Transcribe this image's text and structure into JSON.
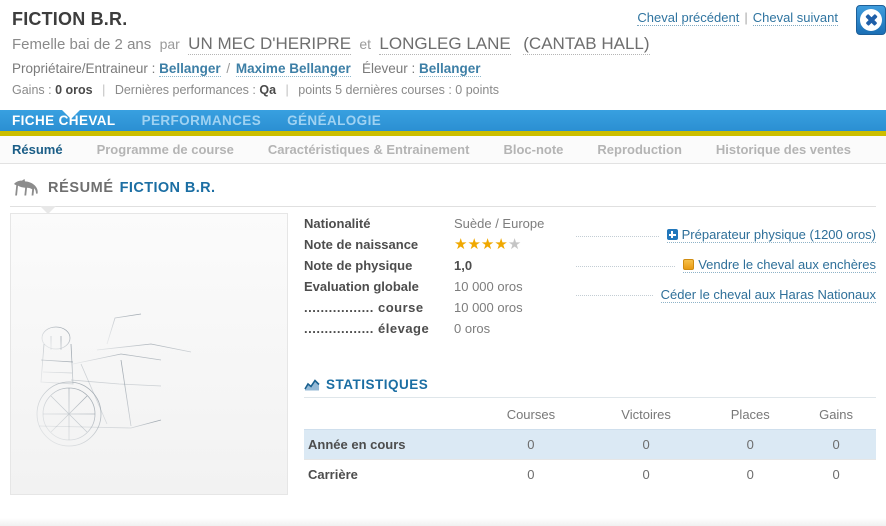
{
  "header": {
    "horse_name": "FICTION B.R.",
    "description": "Femelle bai de 2 ans",
    "par_label": "par",
    "sire": "UN MEC D'HERIPRE",
    "et_label": "et",
    "dam": "LONGLEG LANE",
    "damsire": "(CANTAB HALL)",
    "owner_label": "Propriétaire/Entraineur :",
    "owner": "Bellanger",
    "owner_sep": "/",
    "trainer": "Maxime Bellanger",
    "breeder_label": "Éleveur :",
    "breeder": "Bellanger",
    "gains_label": "Gains :",
    "gains_value": "0 oros",
    "perf_label": "Dernières performances :",
    "perf_value": "Qa",
    "points_text": "points 5 dernières courses : 0 points",
    "prev_horse": "Cheval précédent",
    "next_horse": "Cheval suivant",
    "link_divider": "|"
  },
  "nav_primary": {
    "tabs": [
      {
        "label": "FICHE CHEVAL",
        "active": true
      },
      {
        "label": "PERFORMANCES",
        "active": false
      },
      {
        "label": "GÉNÉALOGIE",
        "active": false
      }
    ]
  },
  "nav_secondary": {
    "tabs": [
      {
        "label": "Résumé",
        "active": true
      },
      {
        "label": "Programme de course",
        "active": false
      },
      {
        "label": "Caractéristiques & Entrainement",
        "active": false
      },
      {
        "label": "Bloc-note",
        "active": false
      },
      {
        "label": "Reproduction",
        "active": false
      },
      {
        "label": "Historique des ventes",
        "active": false
      }
    ]
  },
  "section": {
    "icon": "horse-icon",
    "title": "RÉSUMÉ",
    "name": "FICTION B.R."
  },
  "attributes": [
    {
      "key": "Nationalité",
      "value": "Suède / Europe",
      "type": "text"
    },
    {
      "key": "Note de naissance",
      "value": "",
      "type": "stars",
      "stars_filled": 4,
      "stars_total": 5
    },
    {
      "key": "Note de physique",
      "value": "1,0",
      "type": "bold"
    },
    {
      "key": "Evaluation globale",
      "value": "10 000 oros",
      "type": "text"
    },
    {
      "key": "................. course",
      "value": "10 000 oros",
      "type": "text"
    },
    {
      "key": "................. élevage",
      "value": "0 oros",
      "type": "text"
    }
  ],
  "actions": [
    {
      "label": "Préparateur physique (1200 oros)",
      "icon": "plus-icon"
    },
    {
      "label": "Vendre le cheval aux enchères",
      "icon": "orange-square-icon"
    },
    {
      "label": "Céder le cheval aux Haras Nationaux",
      "icon": "none"
    }
  ],
  "statistics": {
    "icon": "chart-icon",
    "title": "STATISTIQUES",
    "columns": [
      "",
      "Courses",
      "Victoires",
      "Places",
      "Gains"
    ],
    "rows": [
      {
        "label": "Année en cours",
        "values": [
          "0",
          "0",
          "0",
          "0"
        ],
        "highlight": true
      },
      {
        "label": "Carrière",
        "values": [
          "0",
          "0",
          "0",
          "0"
        ],
        "highlight": false
      }
    ]
  },
  "colors": {
    "nav_blue": "#2b8fd2",
    "nav_gold": "#ccbe00",
    "link_blue": "#2e6f99",
    "accent_blue": "#1b6ea3",
    "star_gold": "#f0a800",
    "row_highlight": "#dbe9f4"
  }
}
